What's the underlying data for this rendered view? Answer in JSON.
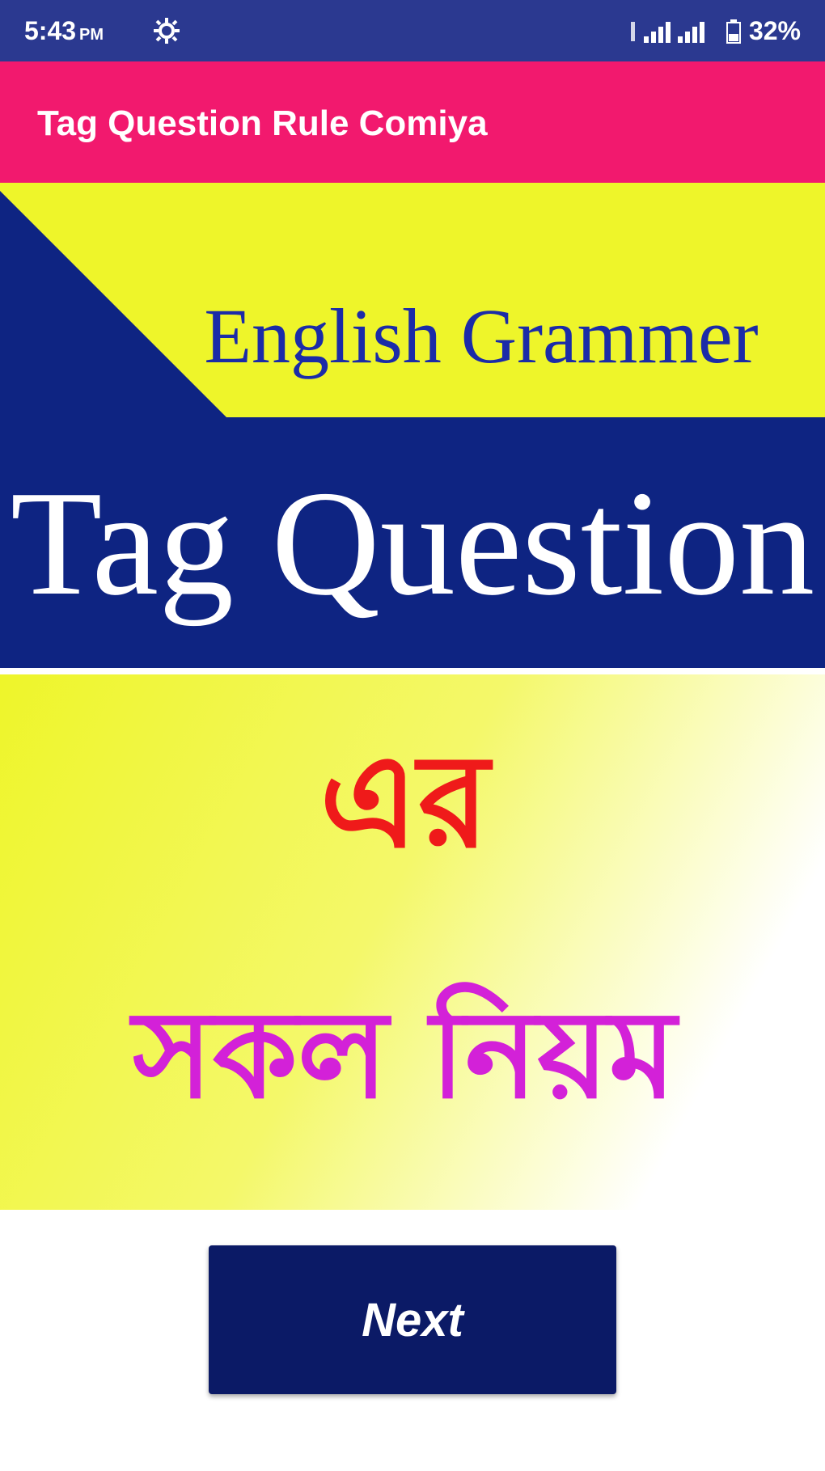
{
  "status_bar": {
    "time": "5:43",
    "ampm": "PM",
    "battery_percent": "32%",
    "icons": [
      "settings-icon",
      "signal-icon",
      "battery-icon"
    ]
  },
  "app_bar": {
    "title": "Tag Question Rule Comiya"
  },
  "banner": {
    "subtitle": "English Grammer",
    "title": "Tag Question",
    "bangla_line1": "এর",
    "bangla_line2": "সকল নিয়ম"
  },
  "next_button": {
    "label": "Next"
  },
  "colors": {
    "status_bar": "#2b3990",
    "app_bar": "#f2196e",
    "banner_blue": "#0e2482",
    "banner_yellow": "#eef52a",
    "subtitle_text": "#1b2ba8",
    "bangla_red": "#ef1a1a",
    "bangla_magenta": "#d321d8",
    "button": "#0b1a66"
  }
}
